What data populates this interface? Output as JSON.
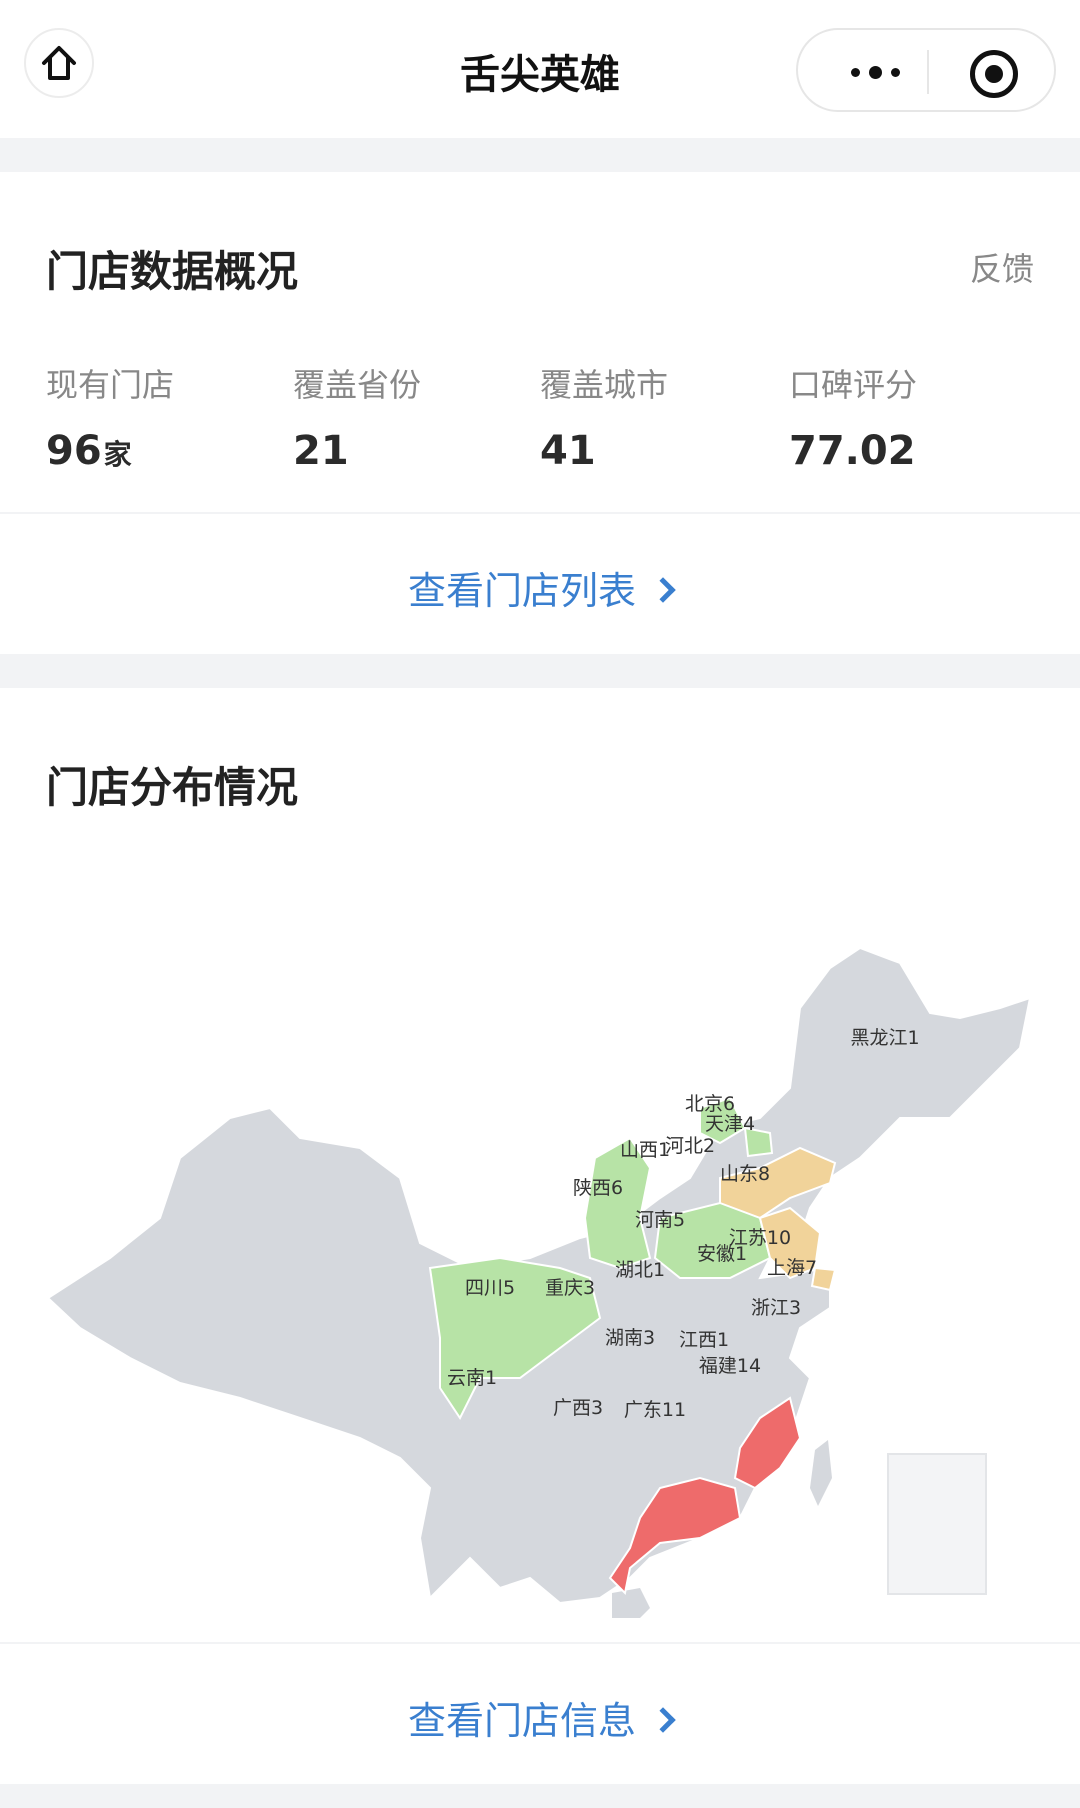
{
  "nav": {
    "title": "舌尖英雄"
  },
  "overview": {
    "title": "门店数据概况",
    "feedback": "反馈",
    "stats": [
      {
        "label": "现有门店",
        "value": "96",
        "unit": "家"
      },
      {
        "label": "覆盖省份",
        "value": "21",
        "unit": ""
      },
      {
        "label": "覆盖城市",
        "value": "41",
        "unit": ""
      },
      {
        "label": "口碑评分",
        "value": "77.02",
        "unit": ""
      }
    ],
    "link": "查看门店列表"
  },
  "distribution": {
    "title": "门店分布情况",
    "link": "查看门店信息",
    "colors": {
      "none": "#d5d8dd",
      "low": "#b7e3a6",
      "mid": "#f1d39a",
      "high": "#ee6b6b",
      "border": "#ffffff"
    },
    "regions": [
      {
        "label": "黑龙江1",
        "stores": 1,
        "tier": "none"
      },
      {
        "label": "北京6",
        "stores": 6,
        "tier": "low"
      },
      {
        "label": "天津4",
        "stores": 4,
        "tier": "low"
      },
      {
        "label": "山西1",
        "stores": 1,
        "tier": "none"
      },
      {
        "label": "河北2",
        "stores": 2,
        "tier": "none"
      },
      {
        "label": "山东8",
        "stores": 8,
        "tier": "mid"
      },
      {
        "label": "陕西6",
        "stores": 6,
        "tier": "low"
      },
      {
        "label": "河南5",
        "stores": 5,
        "tier": "low"
      },
      {
        "label": "江苏10",
        "stores": 10,
        "tier": "mid"
      },
      {
        "label": "安徽1",
        "stores": 1,
        "tier": "none"
      },
      {
        "label": "上海7",
        "stores": 7,
        "tier": "mid"
      },
      {
        "label": "湖北1",
        "stores": 1,
        "tier": "none"
      },
      {
        "label": "四川5",
        "stores": 5,
        "tier": "low"
      },
      {
        "label": "重庆3",
        "stores": 3,
        "tier": "none"
      },
      {
        "label": "浙江3",
        "stores": 3,
        "tier": "none"
      },
      {
        "label": "湖南3",
        "stores": 3,
        "tier": "none"
      },
      {
        "label": "江西1",
        "stores": 1,
        "tier": "none"
      },
      {
        "label": "福建14",
        "stores": 14,
        "tier": "high"
      },
      {
        "label": "云南1",
        "stores": 1,
        "tier": "none"
      },
      {
        "label": "广西3",
        "stores": 3,
        "tier": "none"
      },
      {
        "label": "广东11",
        "stores": 11,
        "tier": "high"
      }
    ]
  }
}
